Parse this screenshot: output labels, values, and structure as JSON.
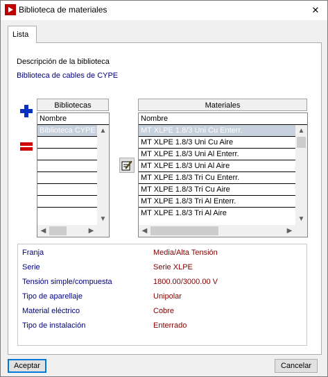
{
  "window": {
    "title": "Biblioteca de materiales",
    "close_glyph": "✕"
  },
  "tabs": [
    {
      "label": "Lista"
    }
  ],
  "description": {
    "label": "Descripción de la biblioteca",
    "value": "Biblioteca de cables de CYPE"
  },
  "libraries": {
    "header": "Bibliotecas",
    "column": "Nombre",
    "items": [
      "Biblioteca CYPE",
      "",
      "",
      "",
      "",
      "",
      "",
      ""
    ],
    "selected_index": 0,
    "add_icon": "plus-icon",
    "delete_icon": "minus-icon"
  },
  "materials": {
    "header": "Materiales",
    "column": "Nombre",
    "items": [
      "MT XLPE 1.8/3 Uni Cu Enterr.",
      "MT XLPE 1.8/3 Uni Cu Aire",
      "MT XLPE 1.8/3 Uni Al Enterr.",
      "MT XLPE 1.8/3 Uni Al Aire",
      "MT XLPE 1.8/3 Tri Cu Enterr.",
      "MT XLPE 1.8/3 Tri Cu Aire",
      "MT XLPE 1.8/3 Tri Al Enterr.",
      "MT XLPE 1.8/3 Tri Al Aire"
    ],
    "selected_index": 0,
    "edit_icon": "edit-icon"
  },
  "properties": [
    {
      "label": "Franja",
      "value": "Media/Alta Tensión"
    },
    {
      "label": "Serie",
      "value": "Serie XLPE"
    },
    {
      "label": "Tensión simple/compuesta",
      "value": "1800.00/3000.00 V"
    },
    {
      "label": "Tipo de aparellaje",
      "value": "Unipolar"
    },
    {
      "label": "Material eléctrico",
      "value": "Cobre"
    },
    {
      "label": "Tipo de instalación",
      "value": "Enterrado"
    }
  ],
  "buttons": {
    "accept": "Aceptar",
    "cancel": "Cancelar"
  },
  "colors": {
    "accent_blue": "#000080",
    "value_red": "#800000",
    "focus": "#0078d7",
    "app_red": "#c00000"
  }
}
